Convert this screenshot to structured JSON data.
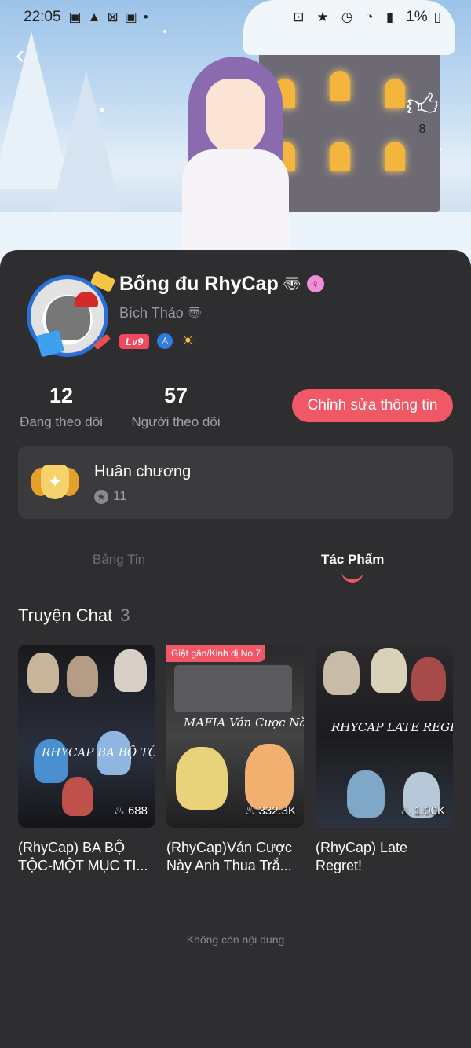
{
  "status_bar": {
    "time": "22:05",
    "battery": "1%"
  },
  "profile": {
    "likes": "8",
    "name": "Bống đu RhyCap",
    "name_symbol": "〠",
    "gender_symbol": "♀",
    "subname": "Bích Thảo 〠",
    "level": "Lv9"
  },
  "stats": {
    "following_count": "12",
    "following_label": "Đang theo dõi",
    "followers_count": "57",
    "followers_label": "Người theo dõi"
  },
  "edit_button": "Chỉnh sửa thông tin",
  "medal": {
    "title": "Huân chương",
    "count": "11"
  },
  "tabs": [
    {
      "label": "Bảng Tin",
      "active": false
    },
    {
      "label": "Tác Phẩm",
      "active": true
    }
  ],
  "section": {
    "title": "Truyện Chat",
    "count": "3"
  },
  "stories": [
    {
      "title": "(RhyCap) BA BỘ TỘC-MỘT MỤC TI...",
      "views": "688",
      "cover_text": "RHYCAP BA BỘ TỘC MỘT MỤC TIÊU"
    },
    {
      "title": "(RhyCap)Ván Cược Này Anh Thua Trắ...",
      "views": "332.3K",
      "rank_badge": "Giật gân/Kinh dị No.7",
      "cover_text": "MAFIA Ván Cược Này"
    },
    {
      "title": "(RhyCap) Late Regret!",
      "views": "1.00K",
      "cover_text": "RHYCAP LATE REGRET"
    }
  ],
  "end_text": "Không còn nội dung",
  "colors": {
    "accent": "#f05866",
    "background": "#2e2e30",
    "card": "#3b3b3e"
  }
}
